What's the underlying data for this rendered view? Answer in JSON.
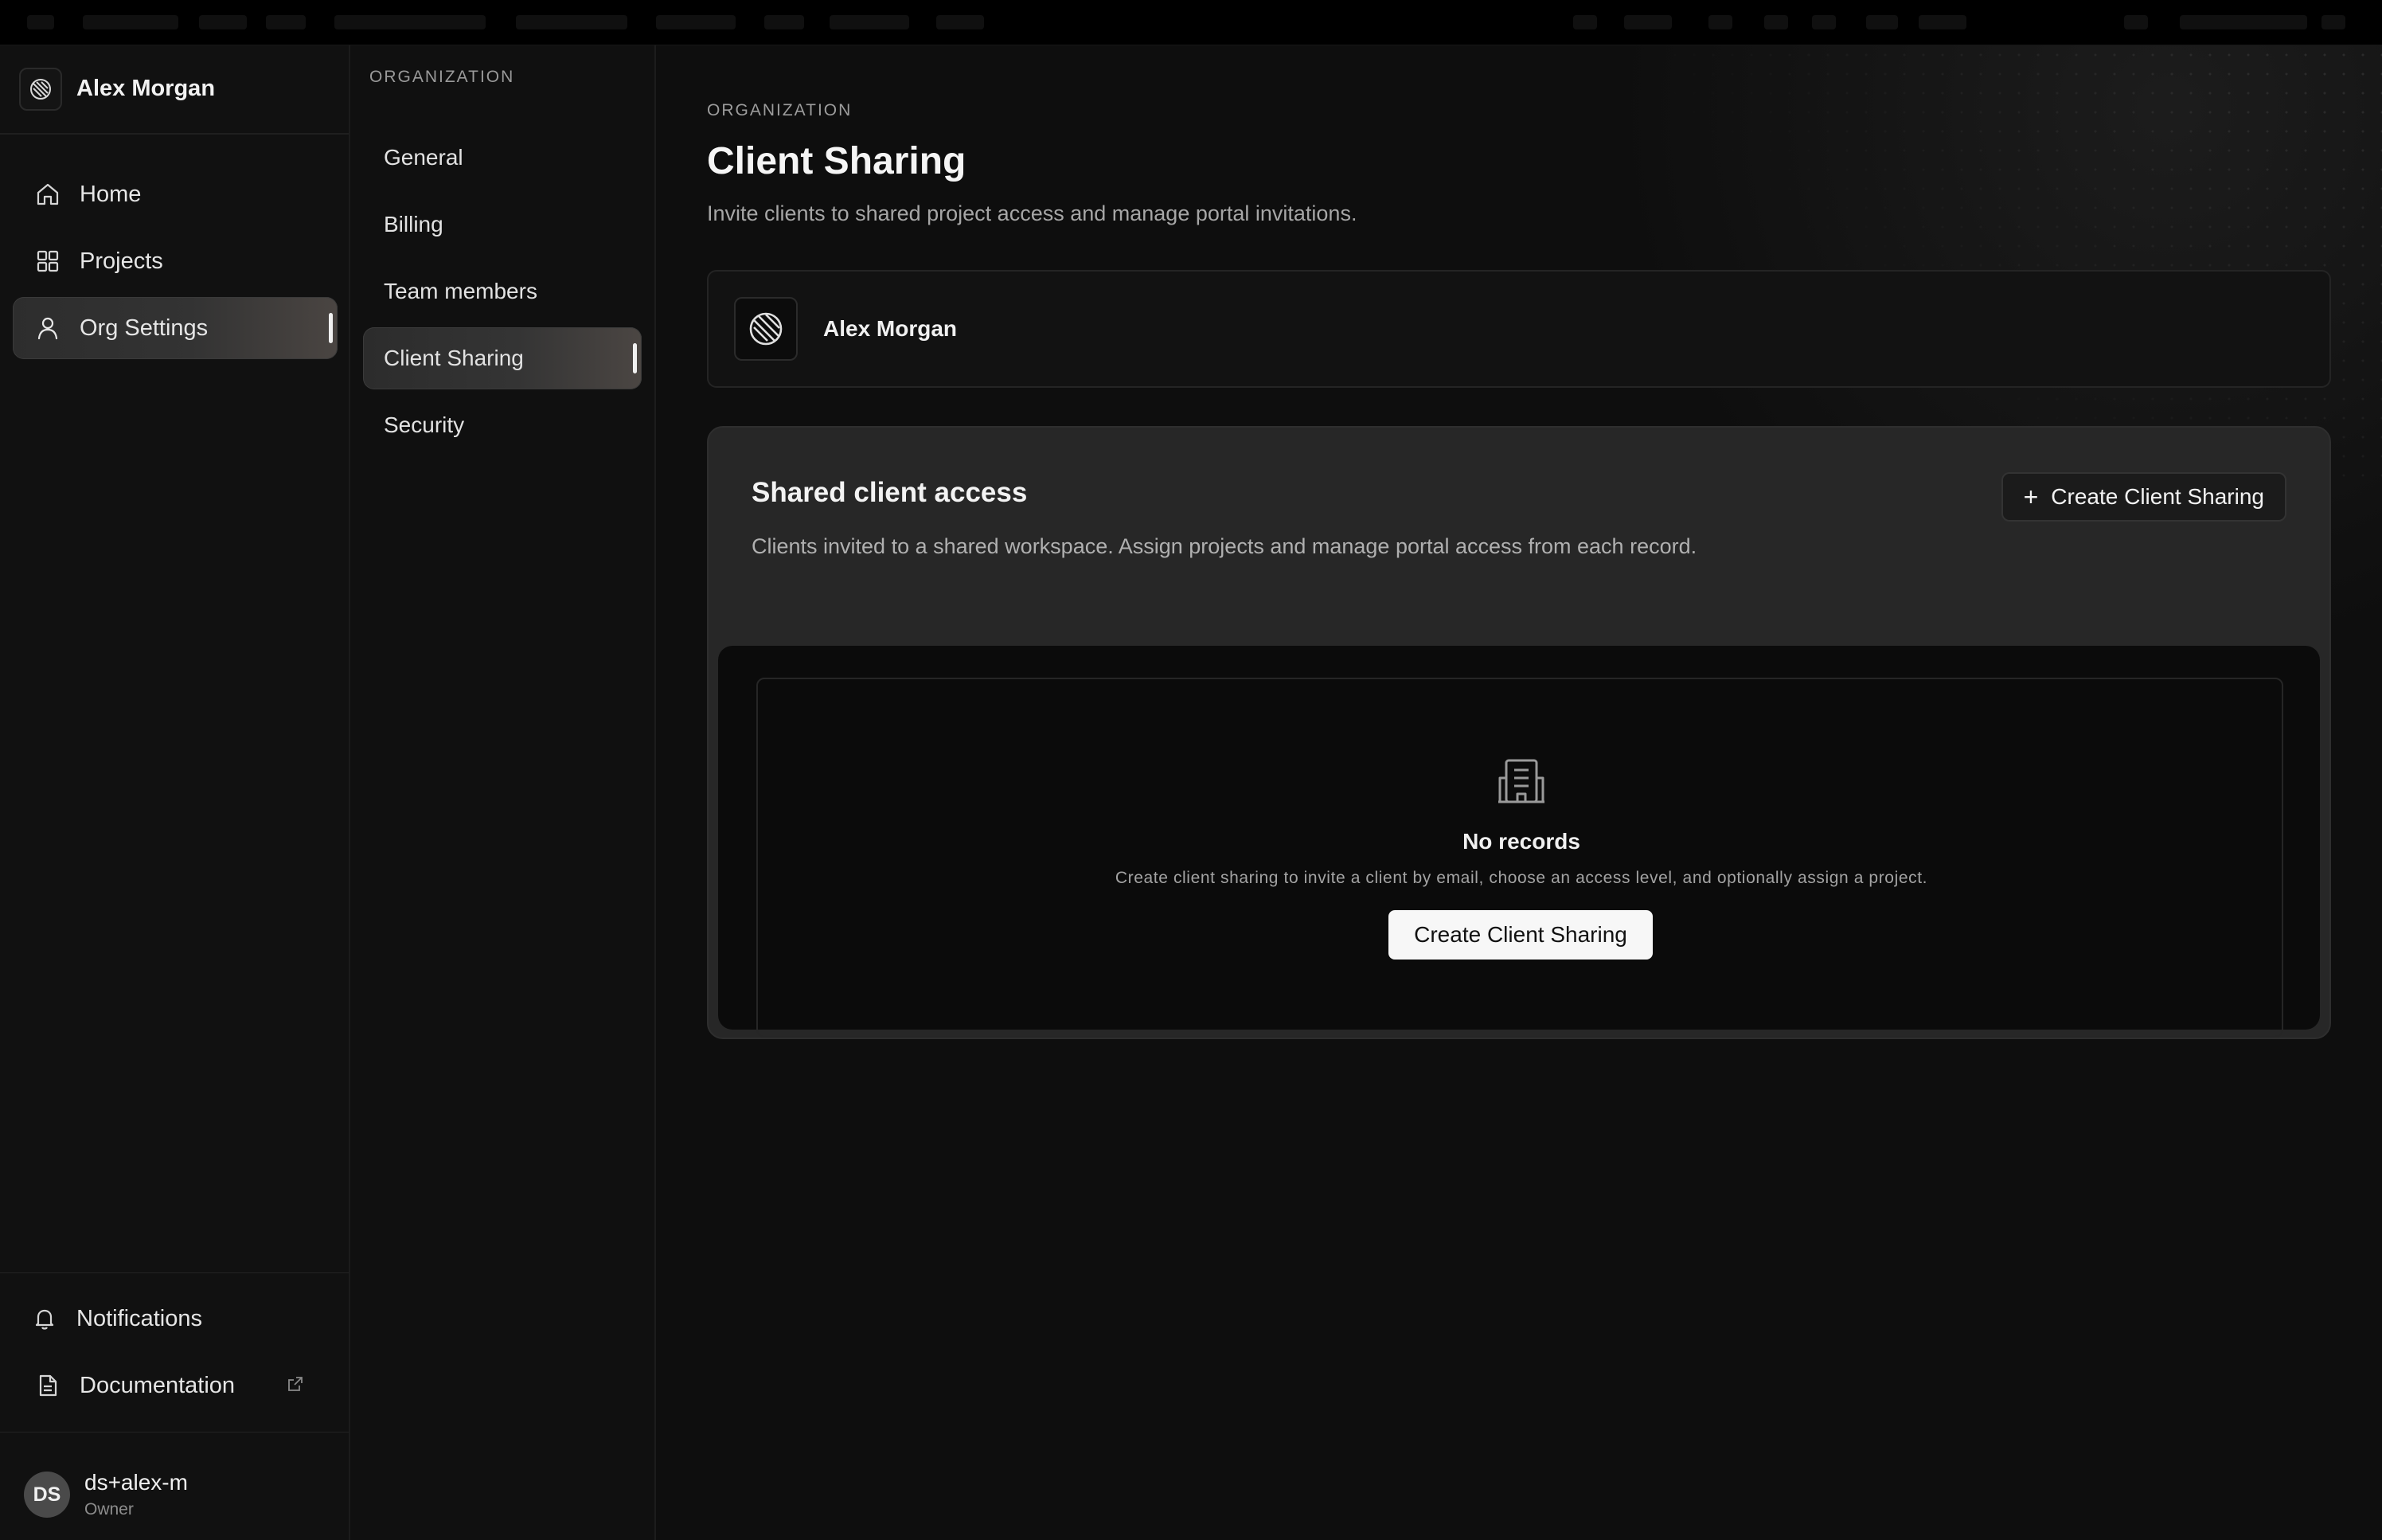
{
  "workspace": {
    "name": "Alex Morgan",
    "logo_icon": "workspace-logo-icon"
  },
  "sidebar": {
    "items": [
      {
        "label": "Home",
        "icon": "home-icon"
      },
      {
        "label": "Projects",
        "icon": "grid-icon"
      },
      {
        "label": "Org Settings",
        "icon": "user-icon",
        "active": true
      }
    ],
    "footer_items": [
      {
        "label": "Notifications",
        "icon": "bell-icon"
      },
      {
        "label": "Documentation",
        "icon": "document-icon",
        "external_icon": "external-link-icon"
      }
    ],
    "user": {
      "initials": "DS",
      "name": "ds+alex-m",
      "role": "Owner"
    }
  },
  "subnav": {
    "heading": "ORGANIZATION",
    "items": [
      {
        "label": "General"
      },
      {
        "label": "Billing"
      },
      {
        "label": "Team members"
      },
      {
        "label": "Client Sharing",
        "active": true
      },
      {
        "label": "Security"
      }
    ]
  },
  "main": {
    "eyebrow": "ORGANIZATION",
    "title": "Client Sharing",
    "description": "Invite clients to shared project access and manage portal invitations.",
    "org_card": {
      "name": "Alex Morgan"
    },
    "panel": {
      "title": "Shared client access",
      "description": "Clients invited to a shared workspace. Assign projects and manage portal access from each record.",
      "create_button": "Create Client Sharing",
      "empty_state": {
        "icon": "building-icon",
        "title": "No records",
        "description": "Create client sharing to invite a client by email, choose an access level, and optionally assign a project.",
        "button": "Create Client Sharing"
      }
    }
  },
  "colors": {
    "background": "#0d0d0d",
    "sidebar": "#111111",
    "panel": "#272727",
    "primary_button": "#f7f7f7",
    "text": "#ececec",
    "muted_text": "#a6a6a6"
  }
}
